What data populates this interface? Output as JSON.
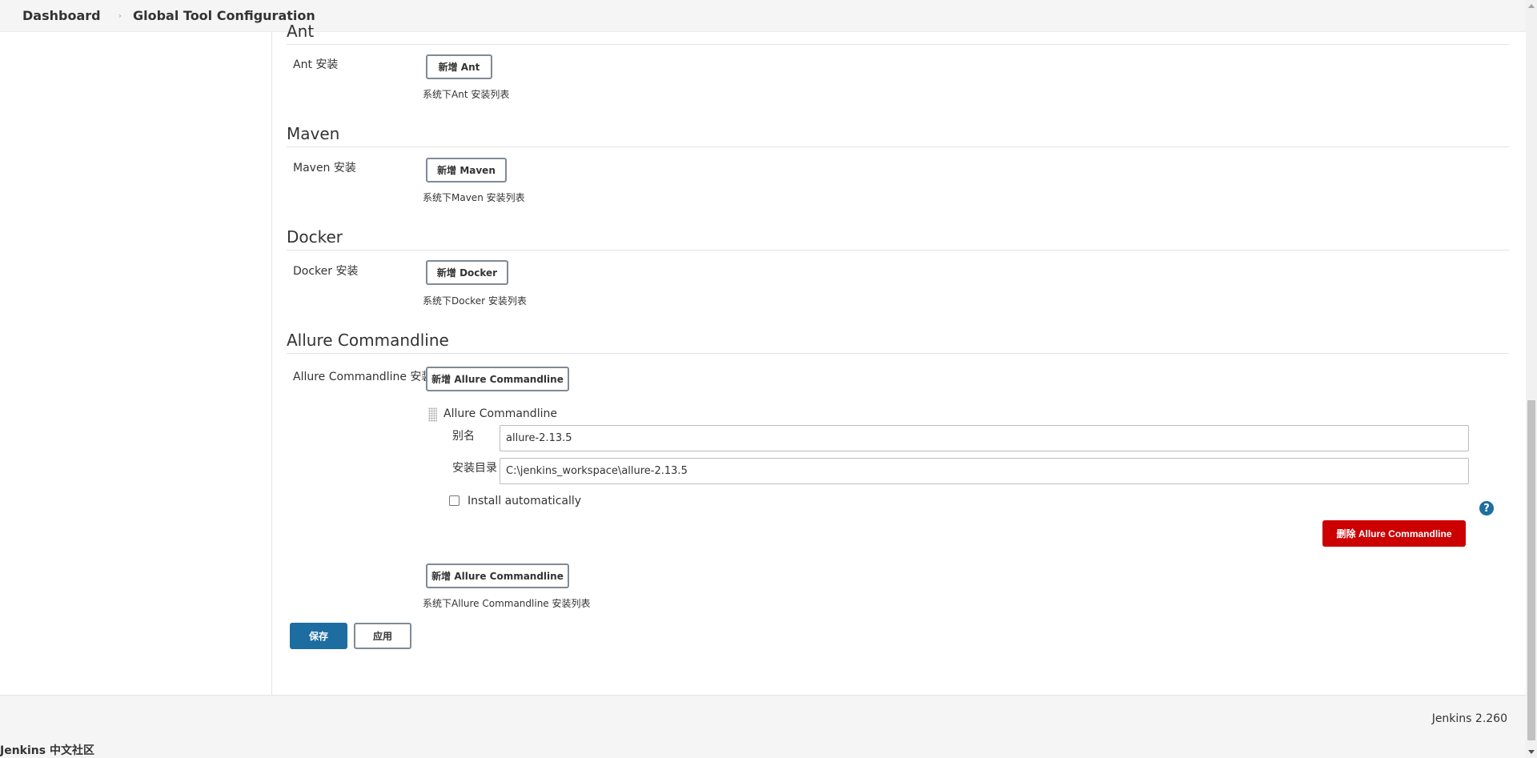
{
  "breadcrumb": {
    "items": [
      "Dashboard",
      "Global Tool Configuration"
    ],
    "separator": "›"
  },
  "sections": {
    "ant": {
      "title": "Ant",
      "label": "Ant 安装",
      "add_button": "新增 Ant",
      "help": "系统下Ant 安装列表"
    },
    "maven": {
      "title": "Maven",
      "label": "Maven 安装",
      "add_button": "新增 Maven",
      "help": "系统下Maven 安装列表"
    },
    "docker": {
      "title": "Docker",
      "label": "Docker 安装",
      "add_button": "新增 Docker",
      "help": "系统下Docker 安装列表"
    },
    "allure": {
      "title": "Allure Commandline",
      "label": "Allure Commandline 安装",
      "add_button_top": "新增 Allure Commandline",
      "installation": {
        "header": "Allure Commandline",
        "name_label": "别名",
        "name_value": "allure-2.13.5",
        "home_label": "安装目录",
        "home_value": "C:\\jenkins_workspace\\allure-2.13.5",
        "auto_install_label": "Install automatically",
        "auto_install_checked": false,
        "help_icon": "?",
        "delete_button": "删除 Allure Commandline"
      },
      "add_button_bottom": "新增 Allure Commandline",
      "help": "系统下Allure Commandline 安装列表"
    }
  },
  "actions": {
    "save": "保存",
    "apply": "应用"
  },
  "footer": {
    "version": "Jenkins 2.260",
    "community": "Jenkins 中文社区"
  },
  "colors": {
    "primary": "#1d6da0",
    "danger": "#cc0003",
    "help_icon": "#1e6ea0"
  }
}
